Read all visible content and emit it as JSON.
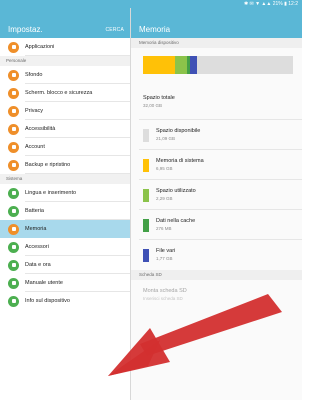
{
  "status": {
    "text": "✱ ✉ ▼ ▲▲ 21% ▮ 12:2"
  },
  "left_panel": {
    "title": "Impostaz.",
    "search_label": "CERCA",
    "items_top": [
      {
        "label": "Applicazioni",
        "color": "#ef8f2a"
      }
    ],
    "section_personal": "Personale",
    "items_personal": [
      {
        "label": "Sfondo",
        "color": "#ef8f2a"
      },
      {
        "label": "Scherm. blocco e sicurezza",
        "color": "#ef8f2a"
      },
      {
        "label": "Privacy",
        "color": "#ef8f2a"
      },
      {
        "label": "Accessibilità",
        "color": "#ef8f2a"
      },
      {
        "label": "Account",
        "color": "#ef8f2a"
      },
      {
        "label": "Backup e ripristino",
        "color": "#ef8f2a"
      }
    ],
    "section_system": "Sistema",
    "items_system": [
      {
        "label": "Lingua e inserimento",
        "color": "#4caf50"
      },
      {
        "label": "Batteria",
        "color": "#4caf50"
      },
      {
        "label": "Memoria",
        "color": "#ef8f2a",
        "active": true
      },
      {
        "label": "Accessori",
        "color": "#4caf50"
      },
      {
        "label": "Data e ora",
        "color": "#4caf50"
      },
      {
        "label": "Manuale utente",
        "color": "#4caf50"
      },
      {
        "label": "Info sul dispositivo",
        "color": "#4caf50"
      }
    ]
  },
  "right_panel": {
    "title": "Memoria",
    "section_device": "Memoria dispositivo",
    "storage_bar": {
      "segments": [
        {
          "name": "system",
          "fraction": 0.21,
          "color": "#ffc107"
        },
        {
          "name": "used",
          "fraction": 0.08,
          "color": "#8bc34a"
        },
        {
          "name": "cache",
          "fraction": 0.02,
          "color": "#43a047"
        },
        {
          "name": "misc",
          "fraction": 0.05,
          "color": "#3f51b5"
        }
      ]
    },
    "total": {
      "title": "Spazio totale",
      "value": "32,00 GB"
    },
    "rows": [
      {
        "title": "Spazio disponibile",
        "value": "21,09 GB",
        "color": "#dddddd"
      },
      {
        "title": "Memoria di sistema",
        "value": "6,95 GB",
        "color": "#ffc107"
      },
      {
        "title": "Spazio utilizzato",
        "value": "2,29 GB",
        "color": "#8bc34a"
      },
      {
        "title": "Dati nella cache",
        "value": "276 MB",
        "color": "#43a047"
      },
      {
        "title": "File vari",
        "value": "1,77 GB",
        "color": "#3f51b5"
      }
    ],
    "section_sd": "Scheda SD",
    "sd": {
      "title": "Monta scheda SD",
      "value": "Inserisci scheda SD"
    }
  },
  "annotation": {
    "arrow_color": "#d32f2f"
  }
}
